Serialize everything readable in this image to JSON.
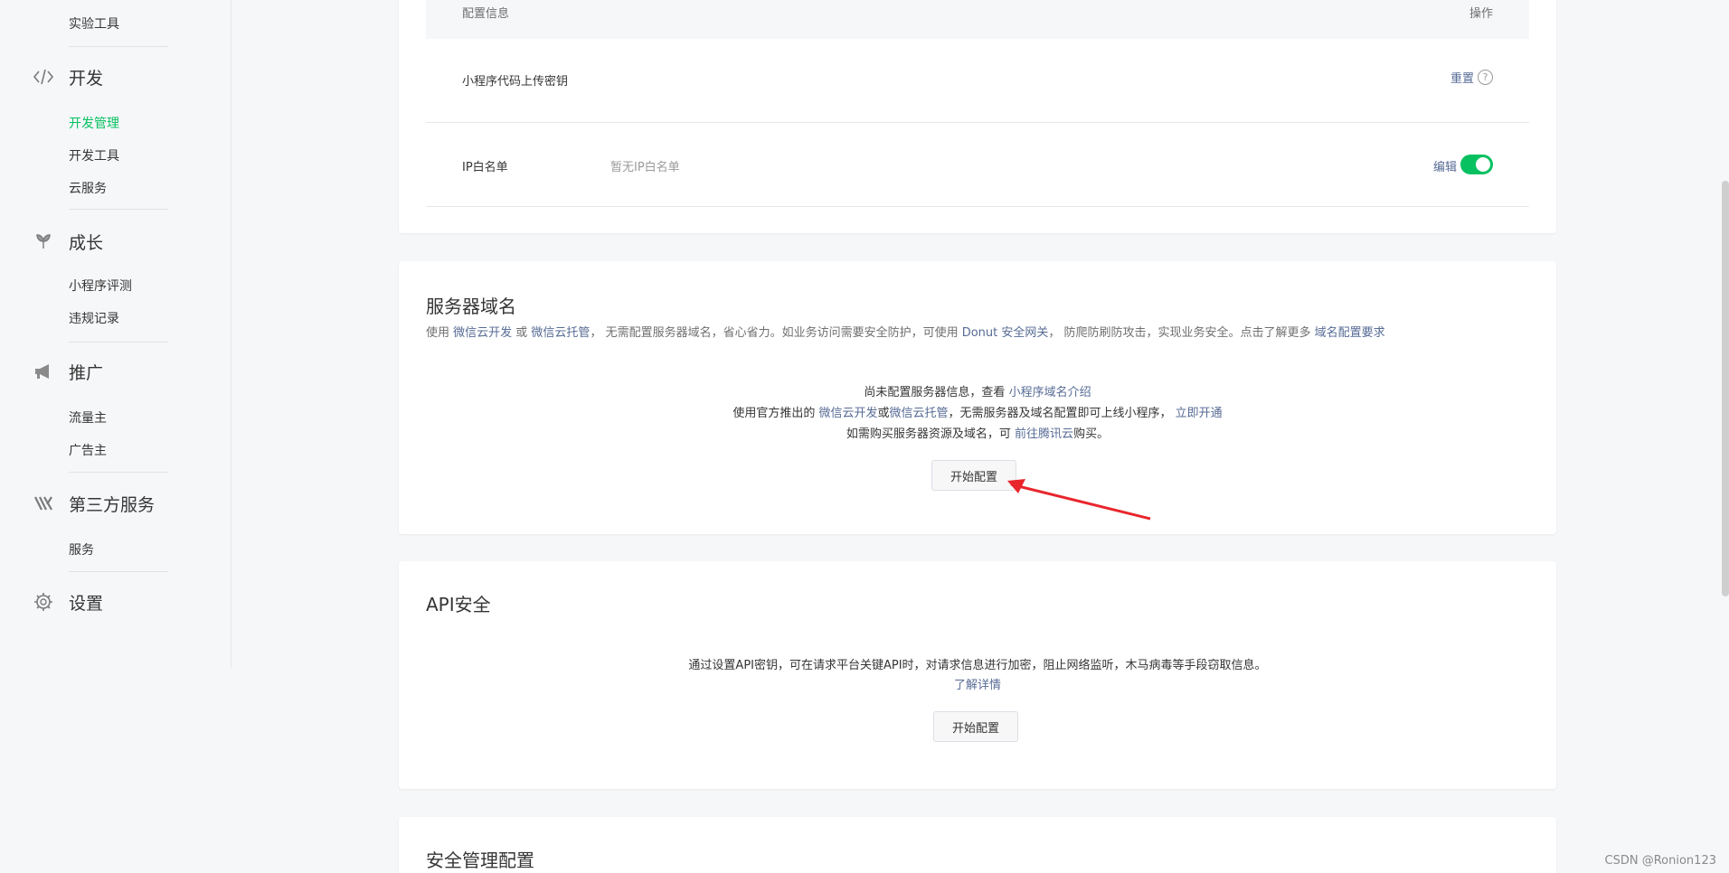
{
  "sidebar": {
    "top_item": "实验工具",
    "groups": [
      {
        "title": "开发",
        "icon": "code-icon",
        "items": [
          "开发管理",
          "开发工具",
          "云服务"
        ]
      },
      {
        "title": "成长",
        "icon": "sprout-icon",
        "items": [
          "小程序评测",
          "违规记录"
        ]
      },
      {
        "title": "推广",
        "icon": "megaphone-icon",
        "items": [
          "流量主",
          "广告主"
        ]
      },
      {
        "title": "第三方服务",
        "icon": "third-party-icon",
        "items": [
          "服务"
        ]
      },
      {
        "title": "设置",
        "icon": "gear-icon",
        "items": []
      }
    ],
    "active_item": "开发管理"
  },
  "config_card": {
    "header_left": "配置信息",
    "header_right": "操作",
    "rows": [
      {
        "label": "小程序代码上传密钥",
        "value": "",
        "action": "重置"
      },
      {
        "label": "IP白名单",
        "value": "暂无IP白名单",
        "action": "编辑"
      }
    ]
  },
  "domain_card": {
    "title": "服务器域名",
    "desc": {
      "p1": "使用 ",
      "link1": "微信云开发",
      "p2": " 或 ",
      "link2": "微信云托管",
      "p3": "， 无需配置服务器域名，省心省力。如业务访问需要安全防护，可使用 ",
      "link3": "Donut 安全网关",
      "p4": "， 防爬防刷防攻击，实现业务安全。点击了解更多 ",
      "link4": "域名配置要求"
    },
    "line1": {
      "text": "尚未配置服务器信息，查看 ",
      "link": "小程序域名介绍"
    },
    "line2": {
      "t1": "使用官方推出的 ",
      "link1": "微信云开发",
      "t2": "或",
      "link2": "微信云托管",
      "t3": "，无需服务器及域名配置即可上线小程序， ",
      "link3": "立即开通"
    },
    "line3": {
      "t1": "如需购买服务器资源及域名，可 ",
      "link": "前往腾讯云",
      "t2": "购买。"
    },
    "button": "开始配置"
  },
  "api_card": {
    "title": "API安全",
    "text": "通过设置API密钥，可在请求平台关键API时，对请求信息进行加密，阻止网络监听，木马病毒等手段窃取信息。",
    "link": "了解详情",
    "button": "开始配置"
  },
  "security_card": {
    "title": "安全管理配置"
  },
  "watermark": "CSDN @Ronion123",
  "colors": {
    "accent": "#07c160",
    "link": "#576b95",
    "arrow": "#e8262c"
  }
}
